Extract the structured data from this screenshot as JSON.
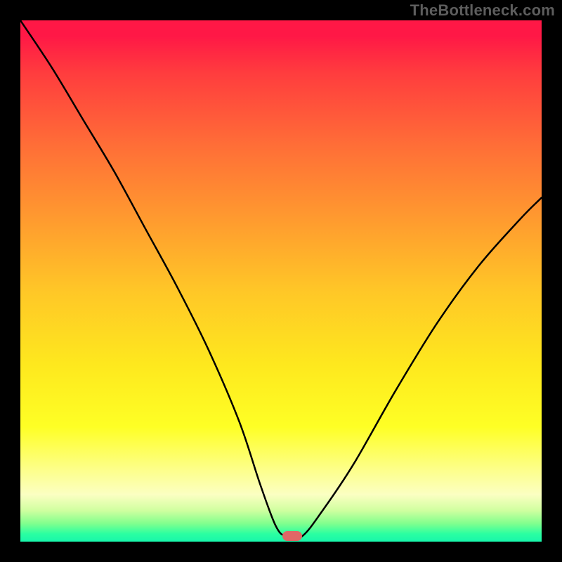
{
  "watermark": "TheBottleneck.com",
  "chart_data": {
    "type": "line",
    "title": "",
    "xlabel": "",
    "ylabel": "",
    "xlim": [
      0,
      100
    ],
    "ylim": [
      0,
      100
    ],
    "series": [
      {
        "name": "bottleneck-curve",
        "x": [
          0,
          6,
          12,
          18,
          24,
          30,
          36,
          42,
          46,
          49,
          51,
          54,
          58,
          64,
          72,
          80,
          88,
          96,
          100
        ],
        "y": [
          100,
          91,
          81,
          71,
          60,
          49,
          37,
          23,
          11,
          3,
          1,
          1,
          6,
          15,
          29,
          42,
          53,
          62,
          66
        ]
      }
    ],
    "marker": {
      "x": 52.2,
      "y": 1.1,
      "color": "#e06666"
    },
    "gradient_stops": [
      {
        "pos": 0.0,
        "color": "#ff1846"
      },
      {
        "pos": 0.03,
        "color": "#ff1846"
      },
      {
        "pos": 0.1,
        "color": "#ff3c3e"
      },
      {
        "pos": 0.24,
        "color": "#ff6e37"
      },
      {
        "pos": 0.38,
        "color": "#ff9a2f"
      },
      {
        "pos": 0.52,
        "color": "#ffc727"
      },
      {
        "pos": 0.66,
        "color": "#fee81e"
      },
      {
        "pos": 0.78,
        "color": "#feff25"
      },
      {
        "pos": 0.86,
        "color": "#fdff88"
      },
      {
        "pos": 0.91,
        "color": "#fbffc2"
      },
      {
        "pos": 0.94,
        "color": "#d0ffa0"
      },
      {
        "pos": 0.965,
        "color": "#82ff8e"
      },
      {
        "pos": 0.985,
        "color": "#2bffa1"
      },
      {
        "pos": 1.0,
        "color": "#18f6ab"
      }
    ]
  }
}
